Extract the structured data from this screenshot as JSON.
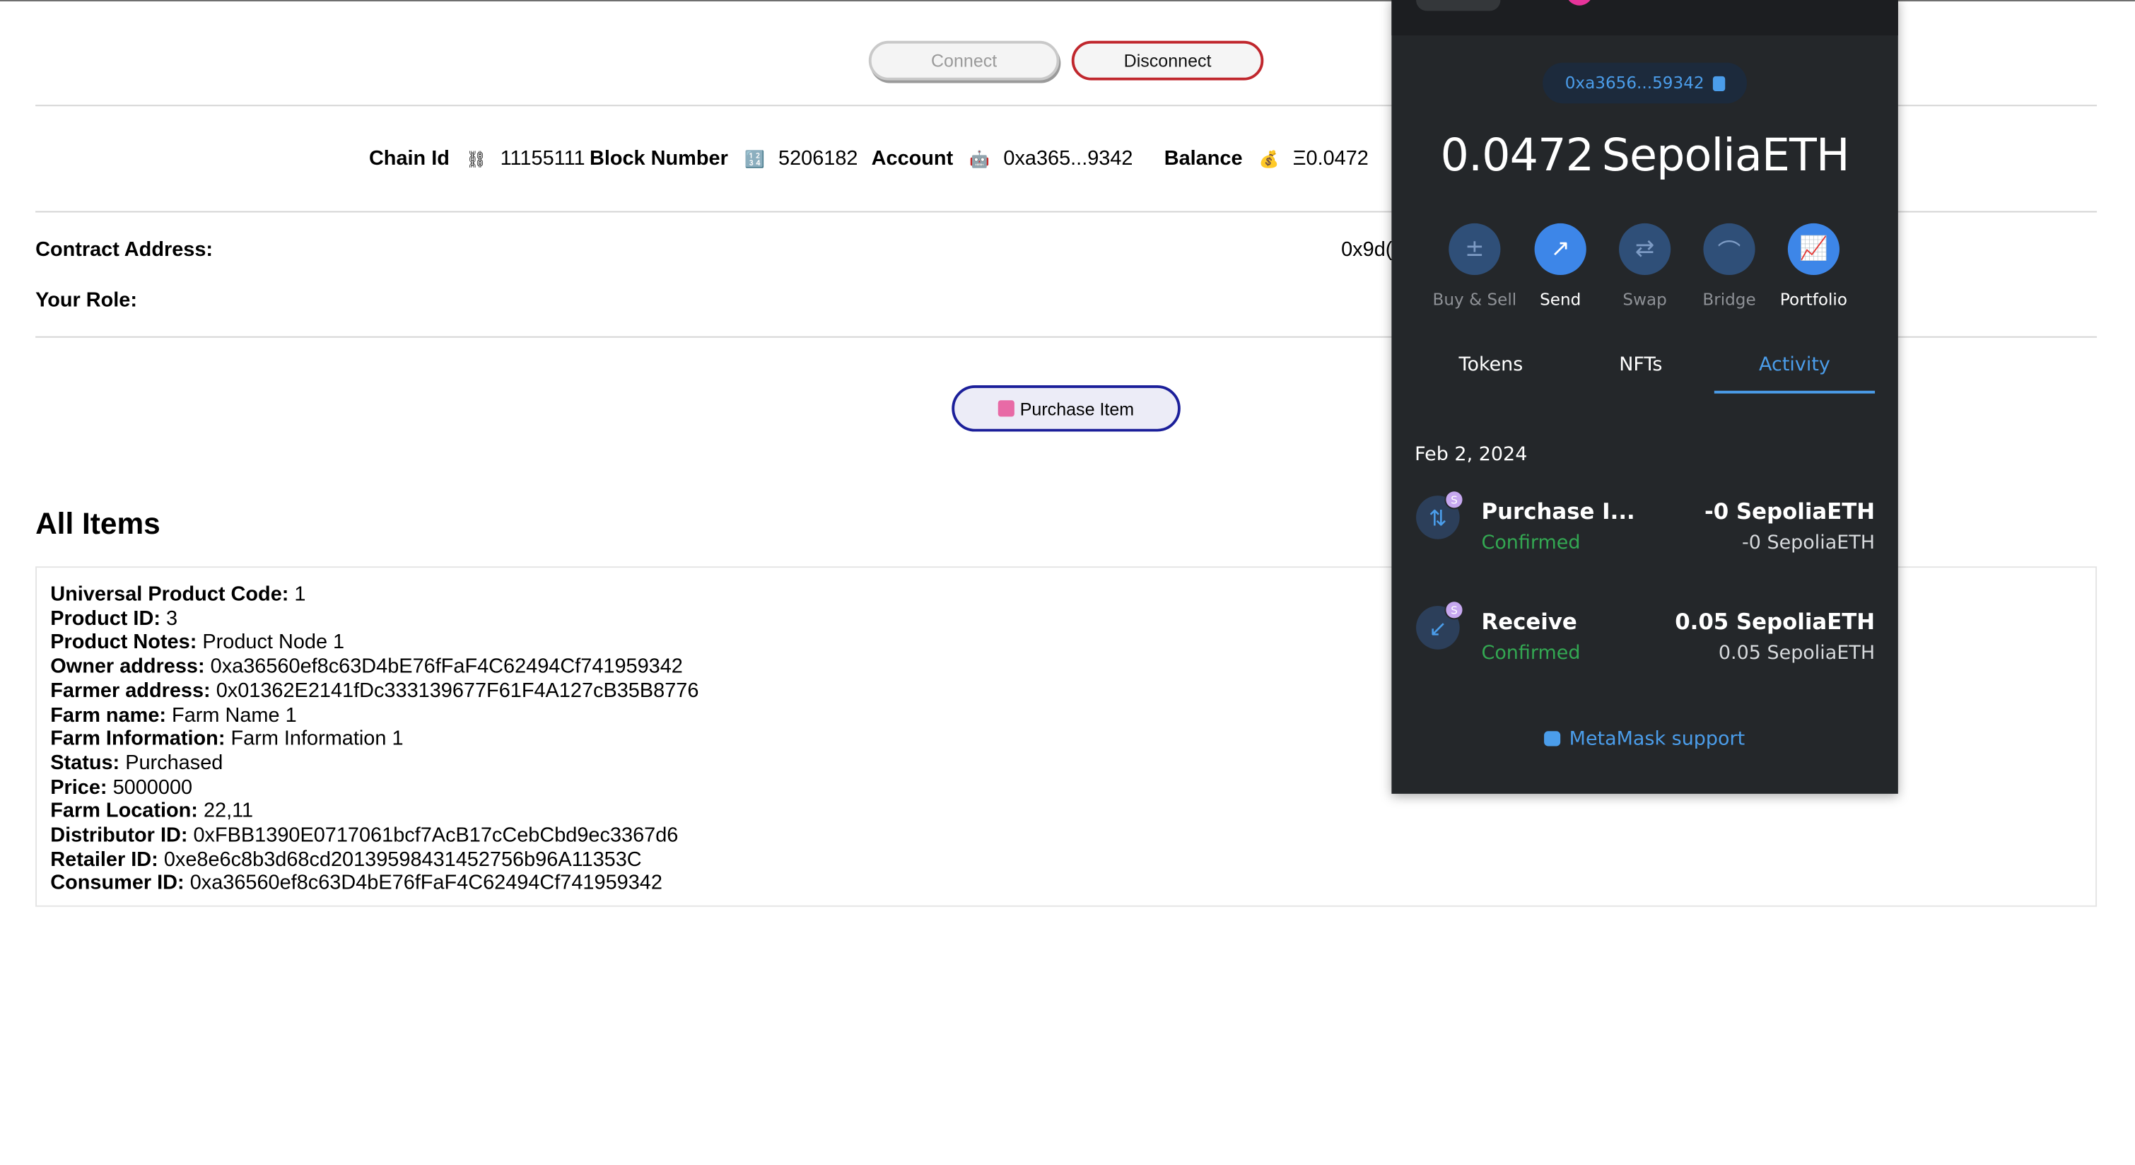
{
  "header": {
    "connect_label": "Connect",
    "disconnect_label": "Disconnect"
  },
  "stats": {
    "chain_label": "Chain Id",
    "chain_icon": "⛓",
    "chain_value": "11155111",
    "block_label": "Block Number",
    "block_icon": "🔢",
    "block_value": "5206182",
    "account_label": "Account",
    "account_icon": "🤖",
    "account_value": "0xa365...9342",
    "balance_label": "Balance",
    "balance_icon": "💰",
    "balance_value": "Ξ0.0472"
  },
  "contract": {
    "label": "Contract Address:",
    "value_fragment": "0x9d("
  },
  "role": {
    "label": "Your Role:"
  },
  "purchase_button": {
    "label": "Purchase Item"
  },
  "items_heading": "All Items",
  "item": [
    {
      "label": "Universal Product Code:",
      "value": " 1"
    },
    {
      "label": "Product ID:",
      "value": " 3"
    },
    {
      "label": "Product Notes:",
      "value": " Product Node 1"
    },
    {
      "label": "Owner address:",
      "value": " 0xa36560ef8c63D4bE76fFaF4C62494Cf741959342"
    },
    {
      "label": "Farmer address:",
      "value": " 0x01362E2141fDc333139677F61F4A127cB35B8776"
    },
    {
      "label": "Farm name:",
      "value": " Farm Name 1"
    },
    {
      "label": "Farm Information:",
      "value": " Farm Information 1"
    },
    {
      "label": "Status:",
      "value": " Purchased"
    },
    {
      "label": "Price:",
      "value": " 5000000"
    },
    {
      "label": "Farm Location:",
      "value": " 22,11"
    },
    {
      "label": "Distributor ID:",
      "value": " 0xFBB1390E0717061bcf7AcB17cCebCbd9ec3367d6"
    },
    {
      "label": "Retailer ID:",
      "value": " 0xe8e6c8b3d68cd20139598431452756b96A11353C"
    },
    {
      "label": "Consumer ID:",
      "value": " 0xa36560ef8c63D4bE76fFaF4C62494Cf741959342"
    }
  ],
  "metamask": {
    "address": "0xa3656...59342",
    "balance_amount": "0.0472",
    "balance_currency": "SepoliaETH",
    "actions": [
      "Buy & Sell",
      "Send",
      "Swap",
      "Bridge",
      "Portfolio"
    ],
    "tabs": [
      "Tokens",
      "NFTs",
      "Activity"
    ],
    "active_tab": "Activity",
    "date": "Feb 2, 2024",
    "transactions": [
      {
        "title": "Purchase I...",
        "status": "Confirmed",
        "amount": "-0 SepoliaETH",
        "sub_amount": "-0 SepoliaETH",
        "badge": "S"
      },
      {
        "title": "Receive",
        "status": "Confirmed",
        "amount": "0.05 SepoliaETH",
        "sub_amount": "0.05 SepoliaETH",
        "badge": "S"
      }
    ],
    "support": "MetaMask support",
    "colors": {
      "accent": "#4b9dea",
      "background": "#24272a",
      "confirmed": "#33a852"
    }
  }
}
